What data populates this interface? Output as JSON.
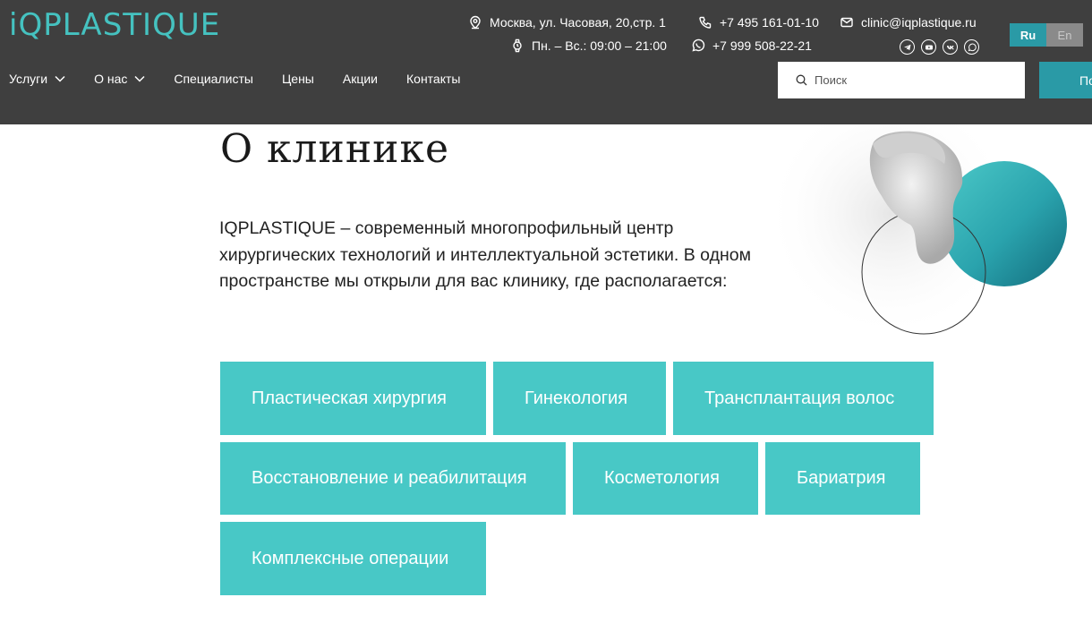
{
  "header": {
    "logo": "iQPLASTIQUE",
    "address": "Москва, ул. Часовая, 20,стр. 1",
    "hours": "Пн. – Вс.: 09:00 – 21:00",
    "phone1": "+7 495 161-01-10",
    "phone2": "+7 999 508-22-21",
    "email": "clinic@iqplastique.ru",
    "socials": [
      "telegram-icon",
      "youtube-icon",
      "vk-icon",
      "whatsapp-icon"
    ],
    "lang": {
      "ru": "Ru",
      "en": "En"
    },
    "nav": [
      "Услуги",
      "О нас",
      "Специалисты",
      "Цены",
      "Акции",
      "Контакты"
    ],
    "search_placeholder": "Поиск",
    "cta_label": "По"
  },
  "main": {
    "title": "О клинике",
    "intro": "IQPLASTIQUE – современный многопрофильный центр хирургических технологий и интеллектуальной эстетики. В одном пространстве мы открыли для вас клинику, где располагается:",
    "tiles": [
      "Пластическая хирургия",
      "Гинекология",
      "Трансплантация волос",
      "Восстановление и реабилитация",
      "Косметология",
      "Бариатрия",
      "Комплексные операции"
    ]
  },
  "colors": {
    "header_bg": "#3f3f3f",
    "accent": "#45c2c0",
    "tile_bg": "#48c8c6",
    "lang_active": "#2a9aa6"
  }
}
